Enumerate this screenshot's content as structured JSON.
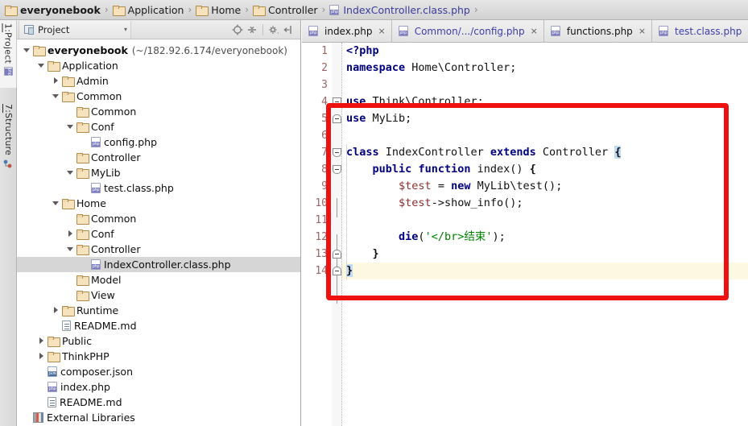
{
  "breadcrumb": {
    "name": "breadcrumb",
    "separator": "›",
    "items": [
      {
        "label": "everyonebook",
        "icon": "folder-icon",
        "bold": true,
        "kind": "folder"
      },
      {
        "label": "Application",
        "icon": "folder-icon",
        "bold": false,
        "kind": "folder"
      },
      {
        "label": "Home",
        "icon": "folder-icon",
        "bold": false,
        "kind": "folder"
      },
      {
        "label": "Controller",
        "icon": "folder-icon",
        "bold": false,
        "kind": "folder"
      },
      {
        "label": "IndexController.class.php",
        "icon": "php-file-icon",
        "bold": false,
        "kind": "php"
      }
    ]
  },
  "tool_strip": {
    "tabs": [
      {
        "num": "1:",
        "label": " Project",
        "icon": "project-icon",
        "active": true
      },
      {
        "num": "7:",
        "label": " Structure",
        "icon": "structure-icon",
        "active": false
      }
    ]
  },
  "project_panel": {
    "title": "Project",
    "dropdown_caret": "▾",
    "tools": [
      {
        "name": "locate-target-icon",
        "glyph": "⊕"
      },
      {
        "name": "collapse-all-icon",
        "glyph": "≡"
      },
      {
        "name": "settings-gear-icon",
        "glyph": "⚙"
      },
      {
        "name": "hide-panel-icon",
        "glyph": "⦖"
      }
    ],
    "tree": [
      {
        "indent": 0,
        "twisty": "down",
        "icon": "folder-icon",
        "label": "everyonebook",
        "bold": true,
        "path": "(~/182.92.6.174/everyonebook)",
        "selected": false
      },
      {
        "indent": 1,
        "twisty": "down",
        "icon": "folder-icon",
        "label": "Application",
        "bold": false,
        "path": "",
        "selected": false
      },
      {
        "indent": 2,
        "twisty": "right",
        "icon": "folder-icon",
        "label": "Admin",
        "bold": false,
        "path": "",
        "selected": false
      },
      {
        "indent": 2,
        "twisty": "down",
        "icon": "folder-icon",
        "label": "Common",
        "bold": false,
        "path": "",
        "selected": false
      },
      {
        "indent": 3,
        "twisty": "none",
        "icon": "folder-icon",
        "label": "Common",
        "bold": false,
        "path": "",
        "selected": false
      },
      {
        "indent": 3,
        "twisty": "down",
        "icon": "folder-icon",
        "label": "Conf",
        "bold": false,
        "path": "",
        "selected": false
      },
      {
        "indent": 4,
        "twisty": "none",
        "icon": "php-file-icon",
        "label": "config.php",
        "bold": false,
        "path": "",
        "selected": false
      },
      {
        "indent": 3,
        "twisty": "none",
        "icon": "folder-icon",
        "label": "Controller",
        "bold": false,
        "path": "",
        "selected": false
      },
      {
        "indent": 3,
        "twisty": "down",
        "icon": "folder-icon",
        "label": "MyLib",
        "bold": false,
        "path": "",
        "selected": false
      },
      {
        "indent": 4,
        "twisty": "none",
        "icon": "php-file-icon",
        "label": "test.class.php",
        "bold": false,
        "path": "",
        "selected": false
      },
      {
        "indent": 2,
        "twisty": "down",
        "icon": "folder-icon",
        "label": "Home",
        "bold": false,
        "path": "",
        "selected": false
      },
      {
        "indent": 3,
        "twisty": "none",
        "icon": "folder-icon",
        "label": "Common",
        "bold": false,
        "path": "",
        "selected": false
      },
      {
        "indent": 3,
        "twisty": "right",
        "icon": "folder-icon",
        "label": "Conf",
        "bold": false,
        "path": "",
        "selected": false
      },
      {
        "indent": 3,
        "twisty": "down",
        "icon": "folder-icon",
        "label": "Controller",
        "bold": false,
        "path": "",
        "selected": false
      },
      {
        "indent": 4,
        "twisty": "none",
        "icon": "php-file-icon",
        "label": "IndexController.class.php",
        "bold": false,
        "path": "",
        "selected": true
      },
      {
        "indent": 3,
        "twisty": "none",
        "icon": "folder-icon",
        "label": "Model",
        "bold": false,
        "path": "",
        "selected": false
      },
      {
        "indent": 3,
        "twisty": "none",
        "icon": "folder-icon",
        "label": "View",
        "bold": false,
        "path": "",
        "selected": false
      },
      {
        "indent": 2,
        "twisty": "right",
        "icon": "folder-icon",
        "label": "Runtime",
        "bold": false,
        "path": "",
        "selected": false
      },
      {
        "indent": 2,
        "twisty": "none",
        "icon": "md-file-icon",
        "label": "README.md",
        "bold": false,
        "path": "",
        "selected": false
      },
      {
        "indent": 1,
        "twisty": "right",
        "icon": "folder-icon",
        "label": "Public",
        "bold": false,
        "path": "",
        "selected": false
      },
      {
        "indent": 1,
        "twisty": "right",
        "icon": "folder-icon",
        "label": "ThinkPHP",
        "bold": false,
        "path": "",
        "selected": false
      },
      {
        "indent": 1,
        "twisty": "none",
        "icon": "json-file-icon",
        "label": "composer.json",
        "bold": false,
        "path": "",
        "selected": false
      },
      {
        "indent": 1,
        "twisty": "none",
        "icon": "php-file-icon",
        "label": "index.php",
        "bold": false,
        "path": "",
        "selected": false
      },
      {
        "indent": 1,
        "twisty": "none",
        "icon": "md-file-icon",
        "label": "README.md",
        "bold": false,
        "path": "",
        "selected": false
      },
      {
        "indent": 0,
        "twisty": "none",
        "icon": "external-libraries-icon",
        "label": "External Libraries",
        "bold": false,
        "path": "",
        "selected": false
      }
    ]
  },
  "editor": {
    "tabs": [
      {
        "label": "index.php",
        "icon": "php-file-icon",
        "blue": false,
        "close": "×"
      },
      {
        "label": "Common/.../config.php",
        "icon": "php-file-icon",
        "blue": true,
        "close": "×"
      },
      {
        "label": "functions.php",
        "icon": "php-file-icon",
        "blue": false,
        "close": "×"
      },
      {
        "label": "test.class.php",
        "icon": "php-file-icon",
        "blue": true,
        "close": "×"
      }
    ],
    "line_numbers": [
      "1",
      "2",
      "3",
      "4",
      "5",
      "6",
      "7",
      "8",
      "9",
      "10",
      "11",
      "12",
      "13",
      "14"
    ],
    "code_lines": [
      {
        "n": 1,
        "text": "<?php",
        "current": false
      },
      {
        "n": 2,
        "text": "namespace Home\\Controller;",
        "current": false
      },
      {
        "n": 3,
        "text": "",
        "current": false
      },
      {
        "n": 4,
        "text": "use Think\\Controller;",
        "current": false
      },
      {
        "n": 5,
        "text": "use MyLib;",
        "current": false
      },
      {
        "n": 6,
        "text": "",
        "current": false
      },
      {
        "n": 7,
        "text": "class IndexController extends Controller {",
        "current": false
      },
      {
        "n": 8,
        "text": "    public function index() {",
        "current": false
      },
      {
        "n": 9,
        "text": "        $test = new MyLib\\test();",
        "current": false
      },
      {
        "n": 10,
        "text": "        $test->show_info();",
        "current": false
      },
      {
        "n": 11,
        "text": "",
        "current": false
      },
      {
        "n": 12,
        "text": "        die('</br>结束');",
        "current": false
      },
      {
        "n": 13,
        "text": "    }",
        "current": false
      },
      {
        "n": 14,
        "text": "}",
        "current": true
      }
    ]
  },
  "annotation": {
    "name": "red-highlight-rectangle",
    "color": "#ef1010"
  },
  "colors": {
    "keyword": "#000080",
    "string": "#008000",
    "variable": "#8b2d2d",
    "line_number": "#9c6464",
    "selection": "#d6d6d6",
    "current_line": "#fdf8e2",
    "tab_blue": "#3c3cab",
    "annotation_red": "#ef1010"
  }
}
